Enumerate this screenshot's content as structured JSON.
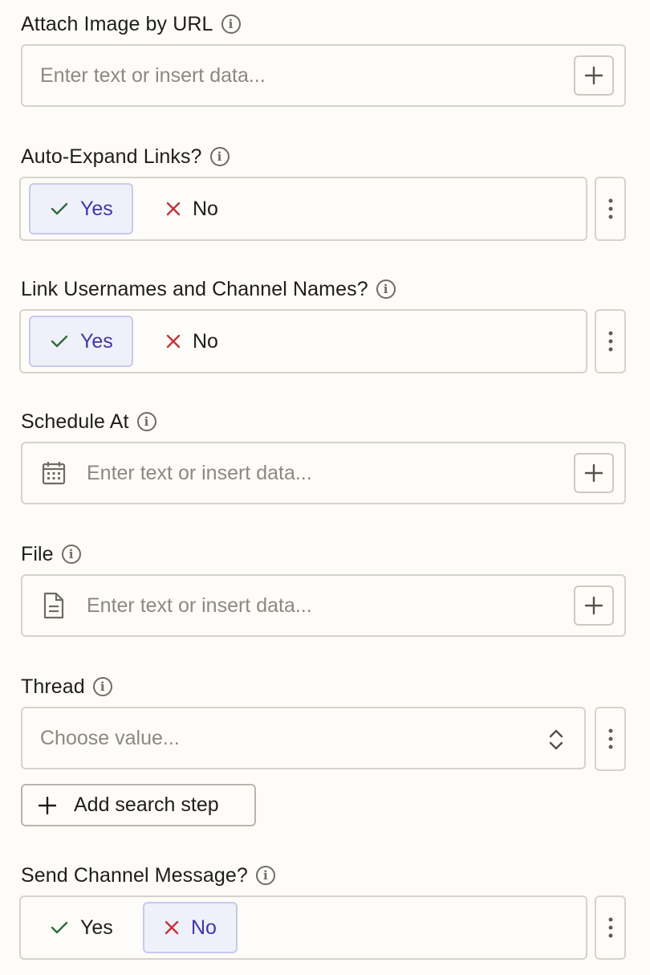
{
  "fields": {
    "attach_image": {
      "label": "Attach Image by URL",
      "placeholder": "Enter text or insert data..."
    },
    "auto_expand": {
      "label": "Auto-Expand Links?",
      "yes": "Yes",
      "no": "No",
      "selected": "yes"
    },
    "link_usernames": {
      "label": "Link Usernames and Channel Names?",
      "yes": "Yes",
      "no": "No",
      "selected": "yes"
    },
    "schedule_at": {
      "label": "Schedule At",
      "placeholder": "Enter text or insert data..."
    },
    "file": {
      "label": "File",
      "placeholder": "Enter text or insert data..."
    },
    "thread": {
      "label": "Thread",
      "placeholder": "Choose value...",
      "add_search_step": "Add search step"
    },
    "send_channel": {
      "label": "Send Channel Message?",
      "yes": "Yes",
      "no": "No",
      "selected": "no"
    }
  },
  "icons": {
    "info": "info-icon",
    "plus": "plus-icon",
    "check": "check-icon",
    "x": "x-icon",
    "calendar": "calendar-icon",
    "file": "file-icon",
    "chevrons": "chevron-up-down-icon",
    "kebab": "kebab-menu-icon"
  },
  "colors": {
    "selected_bg": "#f0f0fb",
    "selected_text": "#3f36a8",
    "check": "#2f6b3a",
    "x": "#c0333b"
  }
}
